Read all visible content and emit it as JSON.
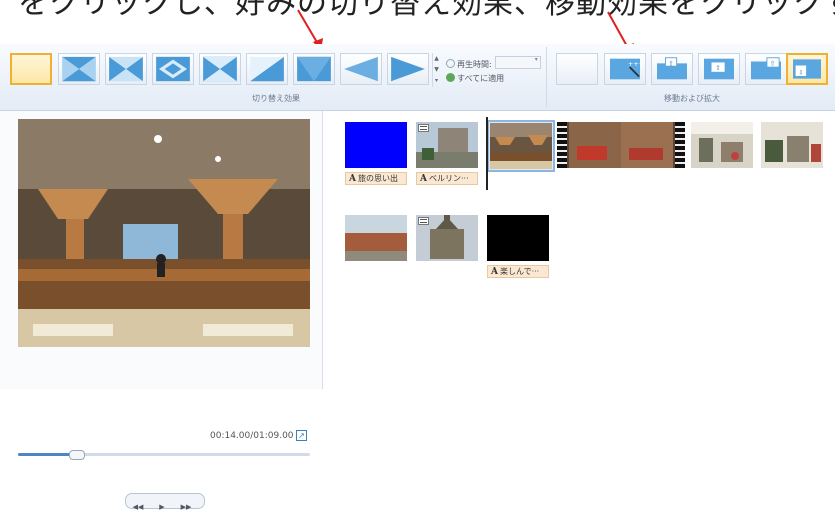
{
  "banner": {
    "text": "をクリックし、好みの切り替え効果、移動効果をクリックする。"
  },
  "ribbon": {
    "transitions_group_label": "切り替え効果",
    "motion_group_label": "移動および拡大",
    "duration_label": "再生時間:",
    "duration_value": "",
    "apply_all_label": "すべてに適用"
  },
  "preview": {
    "time": "00:14.00/01:09.00",
    "progress_fraction": 0.2
  },
  "storyboard": {
    "captions": {
      "clip1": "旅の思い出",
      "clip2": "ベルリン···",
      "clip3_row2": "楽しんで···"
    }
  },
  "colors": {
    "selected_border": "#f0b030",
    "accent": "#4d86c6",
    "annotation_arrow": "#e02020"
  }
}
